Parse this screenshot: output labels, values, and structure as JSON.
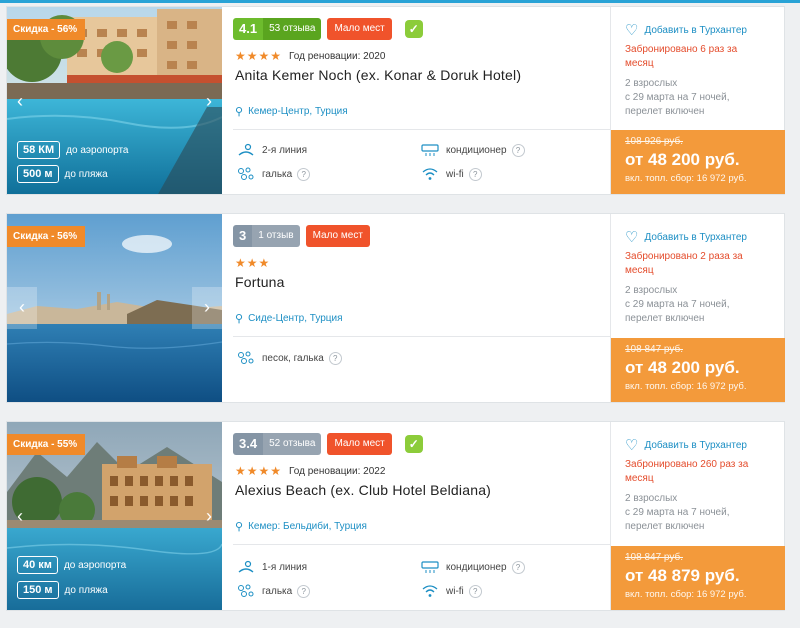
{
  "hotels": [
    {
      "discount": "Скидка - 56%",
      "rating": "4.1",
      "reviews": "53 отзыва",
      "few_places": "Мало мест",
      "stars": "★★★★",
      "renovation": "Год реновации: 2020",
      "name": "Anita Kemer Noch (ex. Konar & Doruk Hotel)",
      "location": "Кемер-Центр, Турция",
      "airport_km": "58 КМ",
      "airport_label": "до аэропорта",
      "beach_m": "500 м",
      "beach_label": "до пляжа",
      "features": [
        "2-я линия",
        "кондиционер",
        "галька",
        "wi-fi"
      ],
      "favorite": "Добавить в Турхантер",
      "booked": "Забронировано 6 раз за месяц",
      "tour": "2 взрослых\nс 29 марта на 7 ночей,\nперелет включен",
      "old_price": "108 926 руб.",
      "price": "от 48 200 руб.",
      "fee": "вкл. топл. сбор: 16 972 руб."
    },
    {
      "discount": "Скидка - 56%",
      "rating": "3",
      "reviews": "1 отзыв",
      "few_places": "Мало мест",
      "stars": "★★★",
      "name": "Fortuna",
      "location": "Сиде-Центр, Турция",
      "features": [
        "песок, галька"
      ],
      "favorite": "Добавить в Турхантер",
      "booked": "Забронировано 2 раза за месяц",
      "tour": "2 взрослых\nс 29 марта на 7 ночей,\nперелет включен",
      "old_price": "108 847 руб.",
      "price": "от 48 200 руб.",
      "fee": "вкл. топл. сбор: 16 972 руб."
    },
    {
      "discount": "Скидка - 55%",
      "rating": "3.4",
      "reviews": "52 отзыва",
      "few_places": "Мало мест",
      "stars": "★★★★",
      "renovation": "Год реновации: 2022",
      "name": "Alexius Beach (ex. Club Hotel Beldiana)",
      "location": "Кемер: Бельдиби, Турция",
      "airport_km": "40 км",
      "airport_label": "до аэропорта",
      "beach_m": "150 м",
      "beach_label": "до пляжа",
      "features": [
        "1-я линия",
        "кондиционер",
        "галька",
        "wi-fi"
      ],
      "favorite": "Добавить в Турхантер",
      "booked": "Забронировано 260 раз за месяц",
      "tour": "2 взрослых\nс 29 марта на 7 ночей,\nперелет включен",
      "old_price": "108 847 руб.",
      "price": "от 48 879 руб.",
      "fee": "вкл. топл. сбор: 16 972 руб."
    }
  ],
  "colors": {
    "accent": "#1d8fc4",
    "discount": "#f08a2a",
    "few_places": "#f0532b",
    "price_block": "#f39a3b",
    "rating_green": "#6dbc2d",
    "rating_gray": "#8595a5"
  }
}
